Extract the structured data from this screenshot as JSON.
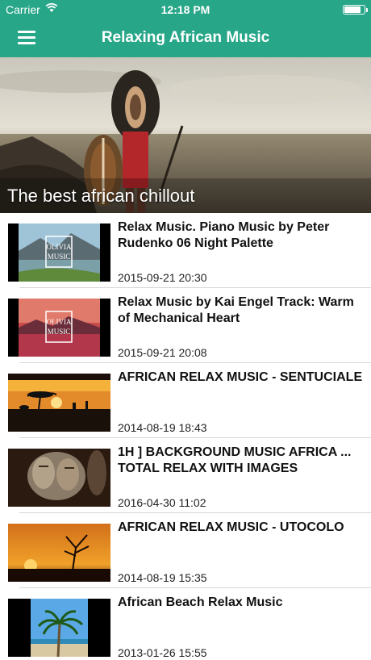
{
  "status": {
    "carrier": "Carrier",
    "time": "12:18 PM",
    "battery_level": 0.85
  },
  "nav": {
    "title": "Relaxing African Music",
    "menu_icon": "hamburger-menu-icon"
  },
  "hero": {
    "caption": "The best african chillout"
  },
  "videos": [
    {
      "title": "Relax Music. Piano Music by Peter Rudenko 06 Night Palette",
      "date": "2015-09-21 20:30",
      "thumb_text": "OLIVIA MUSIC"
    },
    {
      "title": "Relax Music by Kai Engel  Track: Warm of Mechanical Heart",
      "date": "2015-09-21 20:08",
      "thumb_text": "OLIVIA MUSIC"
    },
    {
      "title": "AFRICAN RELAX MUSIC - SENTUCIALE",
      "date": "2014-08-19 18:43"
    },
    {
      "title": "1H ] BACKGROUND MUSIC AFRICA ... TOTAL RELAX  WITH IMAGES",
      "date": "2016-04-30 11:02"
    },
    {
      "title": "AFRICAN RELAX MUSIC - UTOCOLO",
      "date": "2014-08-19 15:35"
    },
    {
      "title": "African Beach Relax Music",
      "date": "2013-01-26 15:55"
    }
  ],
  "colors": {
    "accent": "#27a688"
  }
}
